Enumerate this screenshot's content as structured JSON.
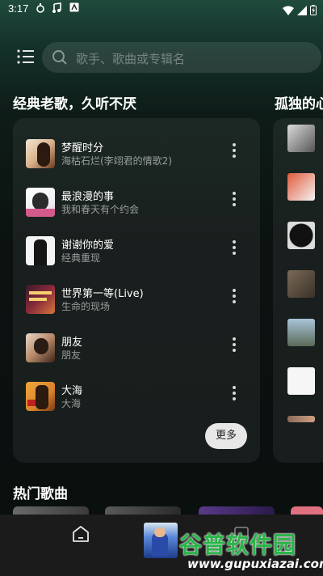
{
  "status_bar": {
    "time": "3:17"
  },
  "search": {
    "placeholder": "歌手、歌曲或专辑名"
  },
  "sections": {
    "classic_title": "经典老歌，久听不厌",
    "lonely_title": "孤独的心",
    "hot_title": "热门歌曲"
  },
  "songs": [
    {
      "title": "梦醒时分",
      "subtitle": "海枯石烂(李翊君的情歌2)"
    },
    {
      "title": "最浪漫的事",
      "subtitle": "我和春天有个约会"
    },
    {
      "title": "谢谢你的爱",
      "subtitle": "经典重现"
    },
    {
      "title": "世界第一等(Live)",
      "subtitle": "生命的现场"
    },
    {
      "title": "朋友",
      "subtitle": "朋友"
    },
    {
      "title": "大海",
      "subtitle": "大海"
    }
  ],
  "more_button": "更多",
  "watermark": {
    "main": "谷普软件园",
    "sub": "www.gupuxiazai.com"
  }
}
